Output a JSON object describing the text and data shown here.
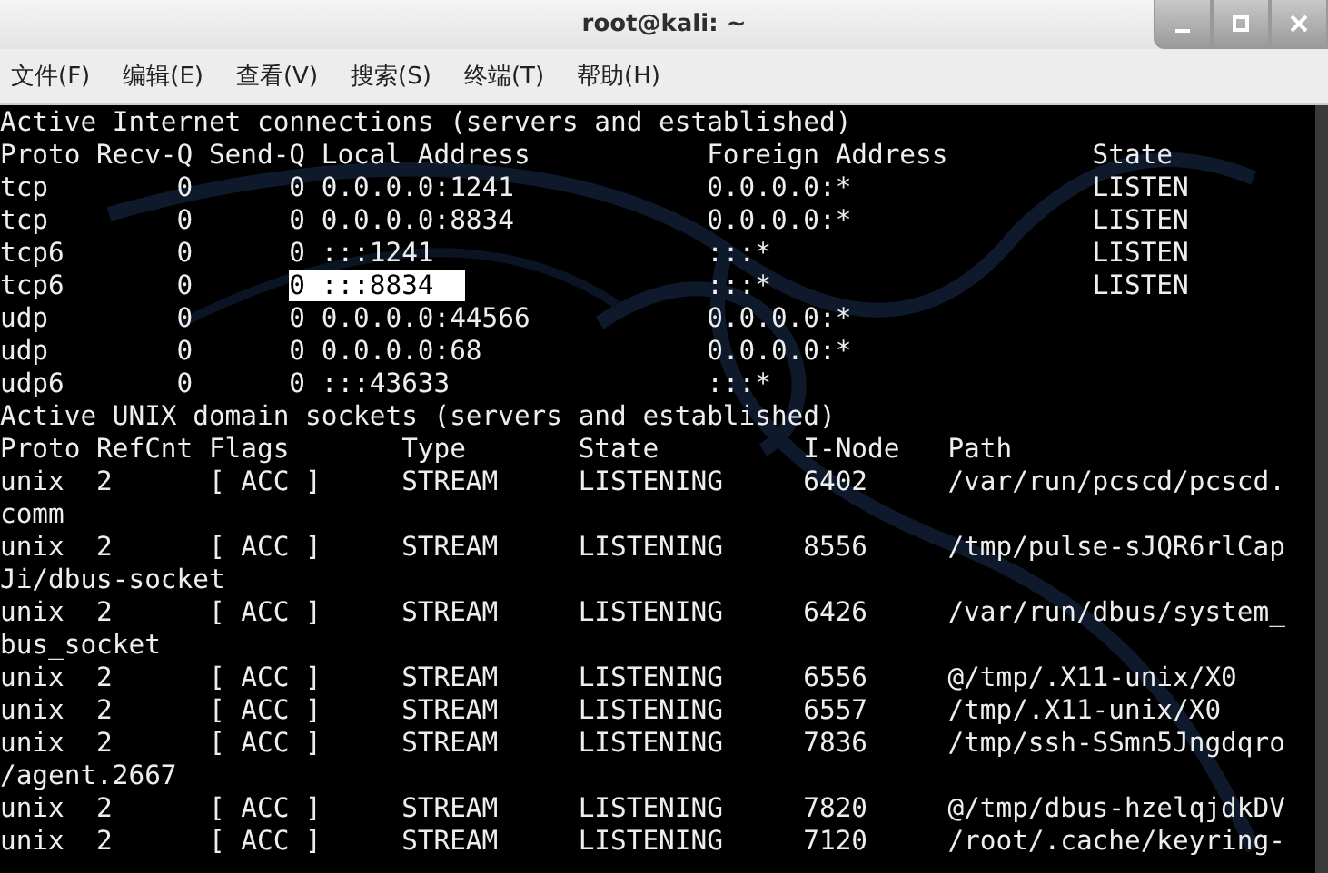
{
  "window": {
    "title": "root@kali: ~"
  },
  "menu": [
    "文件(F)",
    "编辑(E)",
    "查看(V)",
    "搜索(S)",
    "终端(T)",
    "帮助(H)"
  ],
  "terminal": {
    "lines": [
      {
        "segments": [
          {
            "text": "Active Internet connections (servers and established)",
            "selected": false
          }
        ]
      },
      {
        "segments": [
          {
            "text": "Proto Recv-Q Send-Q Local Address           Foreign Address         State",
            "selected": false
          }
        ]
      },
      {
        "segments": [
          {
            "text": "tcp        0      0 0.0.0.0:1241            0.0.0.0:*               LISTEN",
            "selected": false
          }
        ]
      },
      {
        "segments": [
          {
            "text": "tcp        0      0 0.0.0.0:8834            0.0.0.0:*               LISTEN",
            "selected": false
          }
        ]
      },
      {
        "segments": [
          {
            "text": "tcp6       0      0 :::1241                 :::*                    LISTEN",
            "selected": false
          }
        ]
      },
      {
        "segments": [
          {
            "text": "tcp6       0      ",
            "selected": false
          },
          {
            "text": "0 :::8834  ",
            "selected": true
          },
          {
            "text": "               :::*                    LISTEN",
            "selected": false
          }
        ]
      },
      {
        "segments": [
          {
            "text": "udp        0      0 0.0.0.0:44566           0.0.0.0:*",
            "selected": false
          }
        ]
      },
      {
        "segments": [
          {
            "text": "udp        0      0 0.0.0.0:68              0.0.0.0:*",
            "selected": false
          }
        ]
      },
      {
        "segments": [
          {
            "text": "udp6       0      0 :::43633                :::*",
            "selected": false
          }
        ]
      },
      {
        "segments": [
          {
            "text": "Active UNIX domain sockets (servers and established)",
            "selected": false
          }
        ]
      },
      {
        "segments": [
          {
            "text": "Proto RefCnt Flags       Type       State         I-Node   Path",
            "selected": false
          }
        ]
      },
      {
        "segments": [
          {
            "text": "unix  2      [ ACC ]     STREAM     LISTENING     6402     /var/run/pcscd/pcscd.",
            "selected": false
          }
        ]
      },
      {
        "segments": [
          {
            "text": "comm",
            "selected": false
          }
        ]
      },
      {
        "segments": [
          {
            "text": "unix  2      [ ACC ]     STREAM     LISTENING     8556     /tmp/pulse-sJQR6rlCap",
            "selected": false
          }
        ]
      },
      {
        "segments": [
          {
            "text": "Ji/dbus-socket",
            "selected": false
          }
        ]
      },
      {
        "segments": [
          {
            "text": "unix  2      [ ACC ]     STREAM     LISTENING     6426     /var/run/dbus/system_",
            "selected": false
          }
        ]
      },
      {
        "segments": [
          {
            "text": "bus_socket",
            "selected": false
          }
        ]
      },
      {
        "segments": [
          {
            "text": "unix  2      [ ACC ]     STREAM     LISTENING     6556     @/tmp/.X11-unix/X0",
            "selected": false
          }
        ]
      },
      {
        "segments": [
          {
            "text": "unix  2      [ ACC ]     STREAM     LISTENING     6557     /tmp/.X11-unix/X0",
            "selected": false
          }
        ]
      },
      {
        "segments": [
          {
            "text": "unix  2      [ ACC ]     STREAM     LISTENING     7836     /tmp/ssh-SSmn5Jngdqro",
            "selected": false
          }
        ]
      },
      {
        "segments": [
          {
            "text": "/agent.2667",
            "selected": false
          }
        ]
      },
      {
        "segments": [
          {
            "text": "unix  2      [ ACC ]     STREAM     LISTENING     7820     @/tmp/dbus-hzelqjdkDV",
            "selected": false
          }
        ]
      },
      {
        "segments": [
          {
            "text": "unix  2      [ ACC ]     STREAM     LISTENING     7120     /root/.cache/keyring-",
            "selected": false
          }
        ]
      }
    ]
  }
}
